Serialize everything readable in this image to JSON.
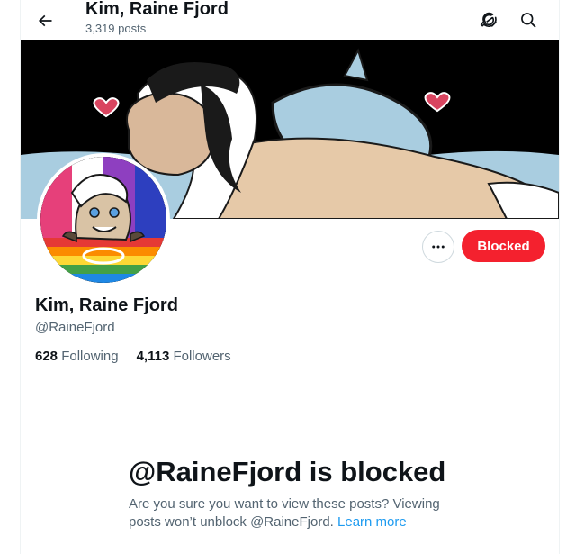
{
  "header": {
    "title": "Kim, Raine Fjord",
    "posts_count": "3,319 posts",
    "back_icon": "arrow-left-icon",
    "grok_icon": "grok-icon",
    "search_icon": "search-icon"
  },
  "profile": {
    "name": "Kim, Raine Fjord",
    "handle": "@RaineFjord",
    "following_count": "628",
    "following_label": "Following",
    "followers_count": "4,113",
    "followers_label": "Followers",
    "blocked_button_label": "Blocked",
    "more_icon": "more-dots-icon"
  },
  "blocked_notice": {
    "title": "@RaineFjord is blocked",
    "description": "Are you sure you want to view these posts? Viewing posts won’t unblock @RaineFjord.",
    "learn_more": "Learn more"
  },
  "colors": {
    "accent_red": "#f4212e",
    "link_blue": "#1d9bf0",
    "secondary_text": "#536471"
  }
}
